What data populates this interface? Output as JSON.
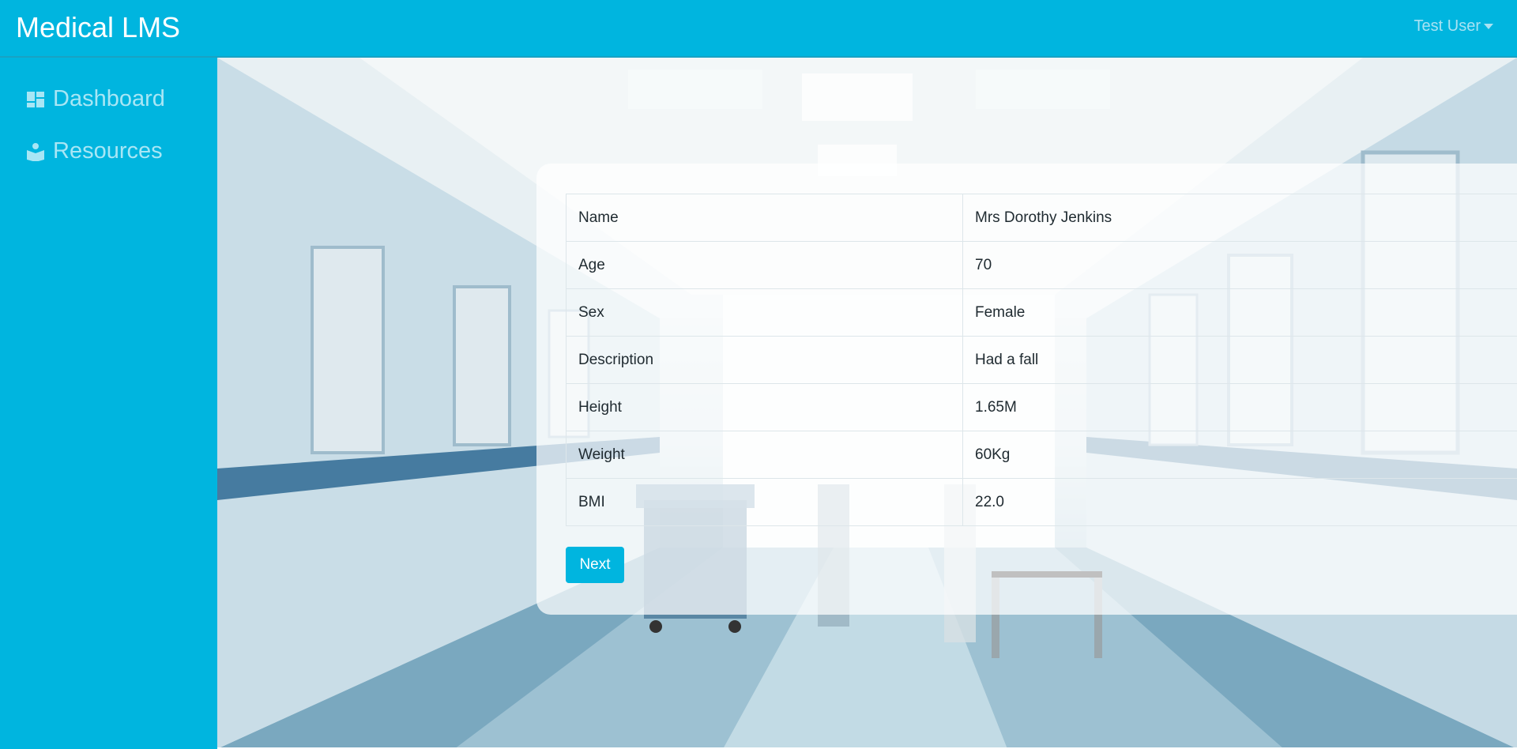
{
  "header": {
    "brand": "Medical LMS",
    "user_name": "Test User"
  },
  "sidebar": {
    "items": [
      {
        "label": "Dashboard",
        "icon": "dashboard-icon"
      },
      {
        "label": "Resources",
        "icon": "book-reader-icon"
      }
    ]
  },
  "patient": {
    "rows": [
      {
        "key": "Name",
        "value": "Mrs Dorothy Jenkins"
      },
      {
        "key": "Age",
        "value": "70"
      },
      {
        "key": "Sex",
        "value": "Female"
      },
      {
        "key": "Description",
        "value": "Had a fall"
      },
      {
        "key": "Height",
        "value": "1.65M"
      },
      {
        "key": "Weight",
        "value": "60Kg"
      },
      {
        "key": "BMI",
        "value": "22.0"
      }
    ],
    "next_label": "Next"
  },
  "colors": {
    "accent": "#00b5df",
    "sidebar_text": "#a8e6f5"
  }
}
